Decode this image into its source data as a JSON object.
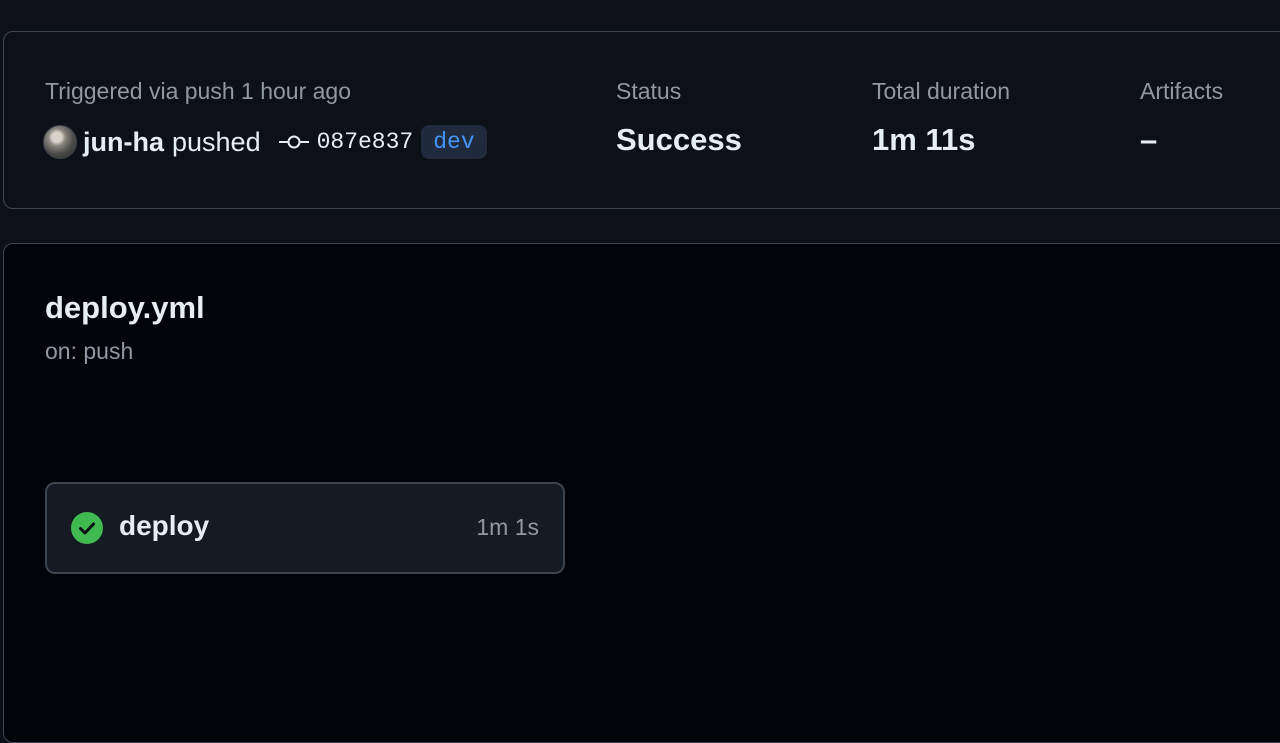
{
  "summary": {
    "trigger_text": "Triggered via push 1 hour ago",
    "author": "jun-ha",
    "action": "pushed",
    "commit_sha": "087e837",
    "branch": "dev",
    "status_label": "Status",
    "status_value": "Success",
    "duration_label": "Total duration",
    "duration_value": "1m 11s",
    "artifacts_label": "Artifacts",
    "artifacts_value": "–"
  },
  "workflow": {
    "file_name": "deploy.yml",
    "trigger": "on: push",
    "jobs": [
      {
        "name": "deploy",
        "duration": "1m 1s",
        "status": "success",
        "icon": "check-circle-icon"
      }
    ]
  },
  "colors": {
    "background": "#0d1117",
    "panel_background": "#010409",
    "border": "#3d444d",
    "text_primary": "#e6edf3",
    "text_muted": "#9198a1",
    "branch_accent": "#4493f8",
    "success": "#3fb950"
  },
  "icons": [
    "avatar",
    "git-commit-icon",
    "check-circle-icon"
  ]
}
